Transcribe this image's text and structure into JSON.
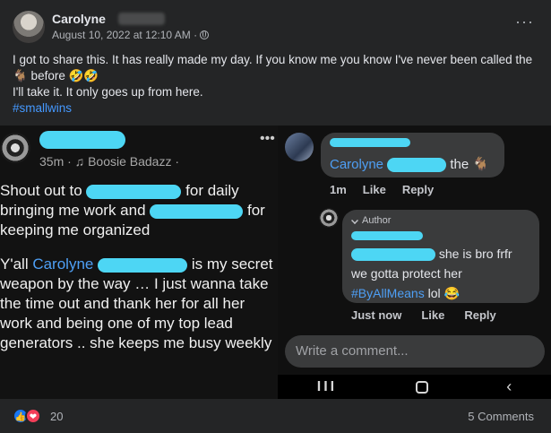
{
  "post": {
    "author": "Carolyne",
    "timestamp": "August 10, 2022 at 12:10 AM ·",
    "body_line1": "I got to share this. It has really made my day. If you know me you know I've never been called the",
    "body_line2": "🐐 before 🤣🤣",
    "body_line3": "I'll take it. It only goes up from here.",
    "hashtag": "#smallwins",
    "more_label": "···"
  },
  "screenshot": {
    "left": {
      "meta": "35m · ♫ Boosie Badazz ·",
      "p1_a": "Shout out to",
      "p1_b": "for daily bringing me work and",
      "p1_c": "for keeping me organized",
      "p2_a": "Y'all",
      "p2_name": "Carolyne",
      "p2_b": "is my secret weapon by the way … I just wanna take the time out and thank her for all her work and being one of my top lead generators .. she keeps me busy weekly",
      "more_label": "•••"
    },
    "right": {
      "comment1_name": "Carolyne",
      "comment1_tail": "the 🐐",
      "comment1_time": "1m",
      "comment1_like": "Like",
      "comment1_reply": "Reply",
      "reply_author_tag": "Author",
      "reply_text_a": "she is bro frfr",
      "reply_text_b": "we gotta protect her",
      "reply_hashtag": "#ByAllMeans",
      "reply_tail": "lol 😂",
      "reply_time": "Just now",
      "reply_like": "Like",
      "reply_reply": "Reply",
      "write_placeholder": "Write a comment...",
      "nav_recent": "III",
      "nav_back": "‹"
    }
  },
  "footer": {
    "reaction_count": "20",
    "comments": "5 Comments",
    "like_icon": "👍",
    "love_icon": "❤"
  },
  "colors": {
    "background": "#242526",
    "link": "#4599ff",
    "redaction": "#4dd6f4"
  }
}
